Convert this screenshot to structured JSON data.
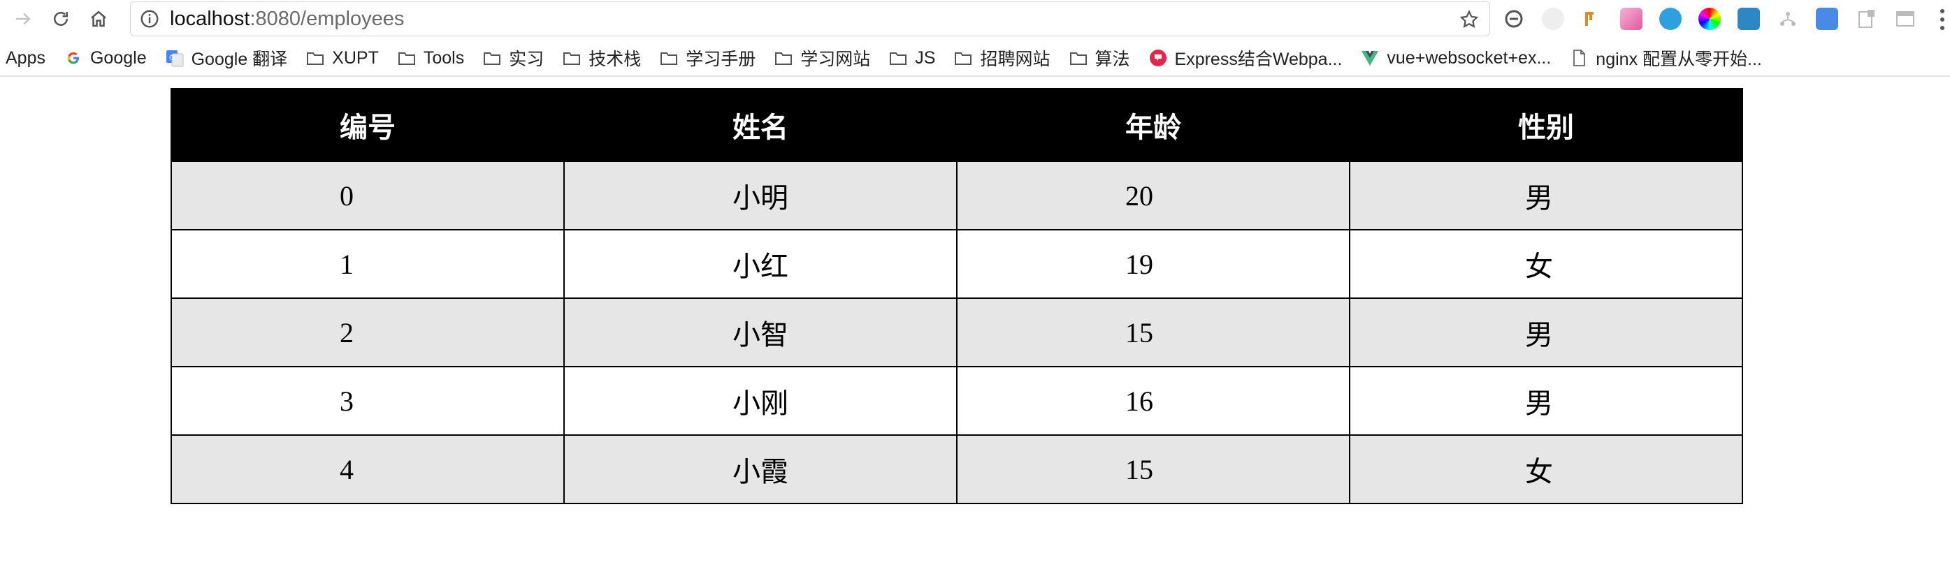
{
  "browser": {
    "url_host": "localhost",
    "url_rest": ":8080/employees"
  },
  "bookmarks": [
    {
      "label": "Apps",
      "icon": "apps-grid-icon"
    },
    {
      "label": "Google",
      "icon": "google-g-icon"
    },
    {
      "label": "Google 翻译",
      "icon": "google-translate-icon"
    },
    {
      "label": "XUPT",
      "icon": "folder-icon"
    },
    {
      "label": "Tools",
      "icon": "folder-icon"
    },
    {
      "label": "实习",
      "icon": "folder-icon"
    },
    {
      "label": "技术栈",
      "icon": "folder-icon"
    },
    {
      "label": "学习手册",
      "icon": "folder-icon"
    },
    {
      "label": "学习网站",
      "icon": "folder-icon"
    },
    {
      "label": "JS",
      "icon": "folder-icon"
    },
    {
      "label": "招聘网站",
      "icon": "folder-icon"
    },
    {
      "label": "算法",
      "icon": "folder-icon"
    },
    {
      "label": "Express结合Webpa...",
      "icon": "express-favicon-icon"
    },
    {
      "label": "vue+websocket+ex...",
      "icon": "vue-favicon-icon"
    },
    {
      "label": "nginx 配置从零开始...",
      "icon": "page-icon"
    }
  ],
  "colors": {
    "header_bg": "#000000",
    "row_odd_bg": "#e6e6e6",
    "row_even_bg": "#ffffff"
  },
  "table": {
    "headers": [
      "编号",
      "姓名",
      "年龄",
      "性别"
    ],
    "rows": [
      [
        "0",
        "小明",
        "20",
        "男"
      ],
      [
        "1",
        "小红",
        "19",
        "女"
      ],
      [
        "2",
        "小智",
        "15",
        "男"
      ],
      [
        "3",
        "小刚",
        "16",
        "男"
      ],
      [
        "4",
        "小霞",
        "15",
        "女"
      ]
    ]
  }
}
